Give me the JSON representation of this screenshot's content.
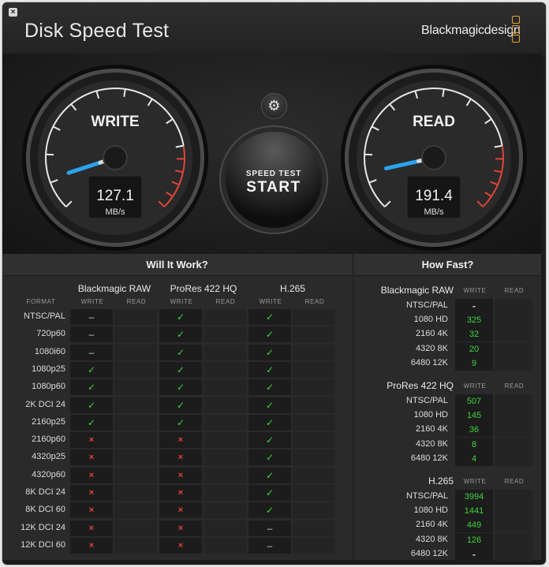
{
  "window": {
    "title": "Disk Speed Test",
    "brand": "Blackmagicdesign",
    "close_glyph": "×"
  },
  "colors": {
    "accent_blue": "#2aa3ee",
    "ok_green": "#3fd33f",
    "fail_red": "#e0443a",
    "brand_orange": "#e7a33b"
  },
  "gauges": {
    "write": {
      "label": "WRITE",
      "value": "127.1",
      "unit": "MB/s",
      "needle_fraction": 0.1
    },
    "read": {
      "label": "READ",
      "value": "191.4",
      "unit": "MB/s",
      "needle_fraction": 0.12
    }
  },
  "settings_icon": "gear-icon",
  "start_button": {
    "line1": "SPEED TEST",
    "line2": "START"
  },
  "will_it_work": {
    "title": "Will It Work?",
    "format_label": "FORMAT",
    "write_label": "WRITE",
    "read_label": "READ",
    "codecs": [
      "Blackmagic RAW",
      "ProRes 422 HQ",
      "H.265"
    ],
    "formats": [
      "NTSC/PAL",
      "720p60",
      "1080i60",
      "1080p25",
      "1080p60",
      "2K DCI 24",
      "2160p25",
      "2160p60",
      "4320p25",
      "4320p60",
      "8K DCI 24",
      "8K DCI 60",
      "12K DCI 24",
      "12K DCI 60"
    ],
    "braw": [
      "na",
      "na",
      "na",
      "ok",
      "ok",
      "ok",
      "ok",
      "no",
      "no",
      "no",
      "no",
      "no",
      "no",
      "no"
    ],
    "prores": [
      "ok",
      "ok",
      "ok",
      "ok",
      "ok",
      "ok",
      "ok",
      "no",
      "no",
      "no",
      "no",
      "no",
      "no",
      "no"
    ],
    "h265": [
      "ok",
      "ok",
      "ok",
      "ok",
      "ok",
      "ok",
      "ok",
      "ok",
      "ok",
      "ok",
      "ok",
      "ok",
      "na",
      "na"
    ],
    "symbols": {
      "ok": "✓",
      "no": "×",
      "na": "–"
    }
  },
  "how_fast": {
    "title": "How Fast?",
    "write_label": "WRITE",
    "read_label": "READ",
    "groups": [
      {
        "name": "Blackmagic RAW",
        "rows": [
          {
            "label": "NTSC/PAL",
            "write": "-"
          },
          {
            "label": "1080 HD",
            "write": "325"
          },
          {
            "label": "2160 4K",
            "write": "32"
          },
          {
            "label": "4320 8K",
            "write": "20"
          },
          {
            "label": "6480 12K",
            "write": "9"
          }
        ]
      },
      {
        "name": "ProRes 422 HQ",
        "rows": [
          {
            "label": "NTSC/PAL",
            "write": "507"
          },
          {
            "label": "1080 HD",
            "write": "145"
          },
          {
            "label": "2160 4K",
            "write": "36"
          },
          {
            "label": "4320 8K",
            "write": "8"
          },
          {
            "label": "6480 12K",
            "write": "4"
          }
        ]
      },
      {
        "name": "H.265",
        "rows": [
          {
            "label": "NTSC/PAL",
            "write": "3994"
          },
          {
            "label": "1080 HD",
            "write": "1441"
          },
          {
            "label": "2160 4K",
            "write": "449"
          },
          {
            "label": "4320 8K",
            "write": "126"
          },
          {
            "label": "6480 12K",
            "write": "-"
          }
        ]
      }
    ]
  }
}
